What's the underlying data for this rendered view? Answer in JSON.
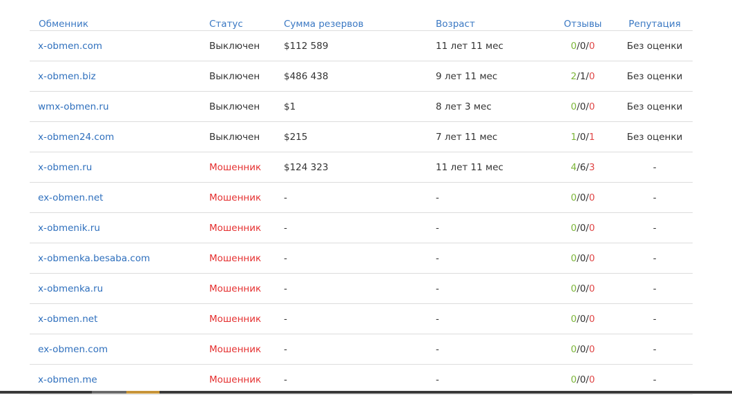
{
  "headers": {
    "exchanger": "Обменник",
    "status": "Статус",
    "reserves": "Сумма резервов",
    "age": "Возраст",
    "reviews": "Отзывы",
    "reputation": "Репутация"
  },
  "rows": [
    {
      "name": "x-obmen.com",
      "status": "Выключен",
      "status_type": "off",
      "reserves": "$112 589",
      "age": "11 лет 11 мес",
      "pos": "0",
      "neu": "0",
      "neg": "0",
      "reputation": "Без оценки"
    },
    {
      "name": "x-obmen.biz",
      "status": "Выключен",
      "status_type": "off",
      "reserves": "$486 438",
      "age": "9 лет 11 мес",
      "pos": "2",
      "neu": "1",
      "neg": "0",
      "reputation": "Без оценки"
    },
    {
      "name": "wmx-obmen.ru",
      "status": "Выключен",
      "status_type": "off",
      "reserves": "$1",
      "age": "8 лет 3 мес",
      "pos": "0",
      "neu": "0",
      "neg": "0",
      "reputation": "Без оценки"
    },
    {
      "name": "x-obmen24.com",
      "status": "Выключен",
      "status_type": "off",
      "reserves": "$215",
      "age": "7 лет 11 мес",
      "pos": "1",
      "neu": "0",
      "neg": "1",
      "reputation": "Без оценки"
    },
    {
      "name": "x-obmen.ru",
      "status": "Мошенник",
      "status_type": "fraud",
      "reserves": "$124 323",
      "age": "11 лет 11 мес",
      "pos": "4",
      "neu": "6",
      "neg": "3",
      "reputation": "-"
    },
    {
      "name": "ex-obmen.net",
      "status": "Мошенник",
      "status_type": "fraud",
      "reserves": "-",
      "age": "-",
      "pos": "0",
      "neu": "0",
      "neg": "0",
      "reputation": "-"
    },
    {
      "name": "x-obmenik.ru",
      "status": "Мошенник",
      "status_type": "fraud",
      "reserves": "-",
      "age": "-",
      "pos": "0",
      "neu": "0",
      "neg": "0",
      "reputation": "-"
    },
    {
      "name": "x-obmenka.besaba.com",
      "status": "Мошенник",
      "status_type": "fraud",
      "reserves": "-",
      "age": "-",
      "pos": "0",
      "neu": "0",
      "neg": "0",
      "reputation": "-"
    },
    {
      "name": "x-obmenka.ru",
      "status": "Мошенник",
      "status_type": "fraud",
      "reserves": "-",
      "age": "-",
      "pos": "0",
      "neu": "0",
      "neg": "0",
      "reputation": "-"
    },
    {
      "name": "x-obmen.net",
      "status": "Мошенник",
      "status_type": "fraud",
      "reserves": "-",
      "age": "-",
      "pos": "0",
      "neu": "0",
      "neg": "0",
      "reputation": "-"
    },
    {
      "name": "ex-obmen.com",
      "status": "Мошенник",
      "status_type": "fraud",
      "reserves": "-",
      "age": "-",
      "pos": "0",
      "neu": "0",
      "neg": "0",
      "reputation": "-"
    },
    {
      "name": "x-obmen.me",
      "status": "Мошенник",
      "status_type": "fraud",
      "reserves": "-",
      "age": "-",
      "pos": "0",
      "neu": "0",
      "neg": "0",
      "reputation": "-"
    }
  ],
  "colors": {
    "link": "#2e6fbd",
    "header": "#3a78c3",
    "fraud": "#e53030",
    "positive": "#7cb53a",
    "negative": "#e04848",
    "divider": "#dcdcdc"
  }
}
